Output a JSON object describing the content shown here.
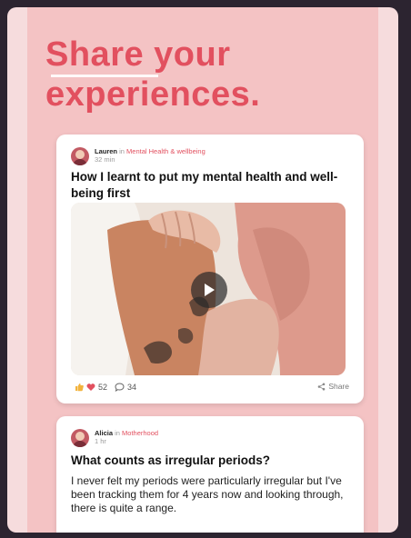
{
  "headline": {
    "line1": "Share your",
    "line2": "experiences."
  },
  "posts": [
    {
      "author": "Lauren",
      "in_word": "in",
      "category": "Mental Health & wellbeing",
      "time": "32 min",
      "title": "How I learnt to put my mental health and well-being first",
      "reactions": "52",
      "comments": "34",
      "share_label": "Share"
    },
    {
      "author": "Alicia",
      "in_word": "in",
      "category": "Motherhood",
      "time": "1 hr",
      "title": "What counts as irregular periods?",
      "body": "I never felt my periods were particularly irregular but I've been tracking them for 4 years now and looking through, there is quite a range."
    }
  ],
  "icons": [
    "play-icon",
    "like-icon",
    "heart-icon",
    "comment-icon",
    "share-icon"
  ],
  "colors": {
    "accent": "#e2505f",
    "background": "#f4c3c4",
    "card": "#ffffff"
  }
}
